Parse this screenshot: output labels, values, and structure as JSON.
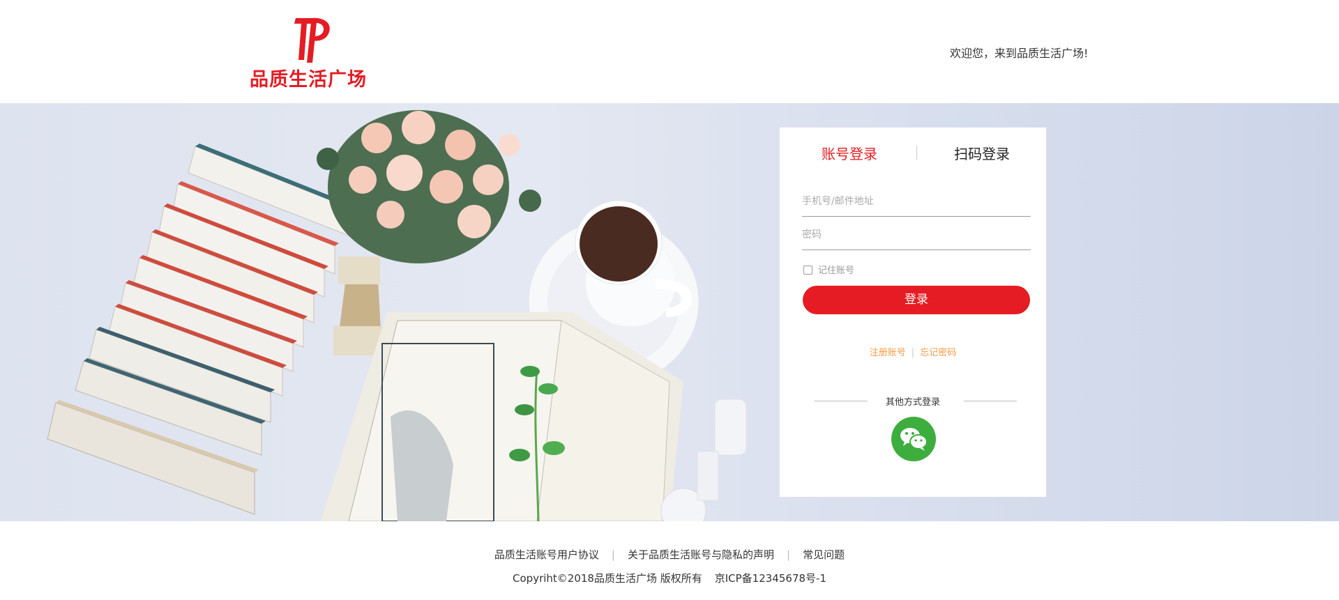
{
  "header": {
    "logo_text": "品质生活广场",
    "logo_mark": "PP",
    "welcome": "欢迎您，来到品质生活广场!"
  },
  "login": {
    "tab_account": "账号登录",
    "tab_qr": "扫码登录",
    "username_placeholder": "手机号/邮件地址",
    "password_placeholder": "密码",
    "remember_label": "记住账号",
    "submit_label": "登录",
    "register_link": "注册账号",
    "forgot_link": "忘记密码",
    "other_methods": "其他方式登录"
  },
  "footer": {
    "links": [
      "品质生活账号用户协议",
      "关于品质生活账号与隐私的声明",
      "常见问题"
    ],
    "copyright": "Copyriht©2018品质生活广场 版权所有",
    "icp": "京ICP备12345678号-1"
  },
  "colors": {
    "brand_red": "#e51c23",
    "link_orange": "#f39a42",
    "wechat_green": "#3dae3d"
  },
  "icons": {
    "logo": "pp-logo-icon",
    "wechat": "wechat-icon"
  }
}
